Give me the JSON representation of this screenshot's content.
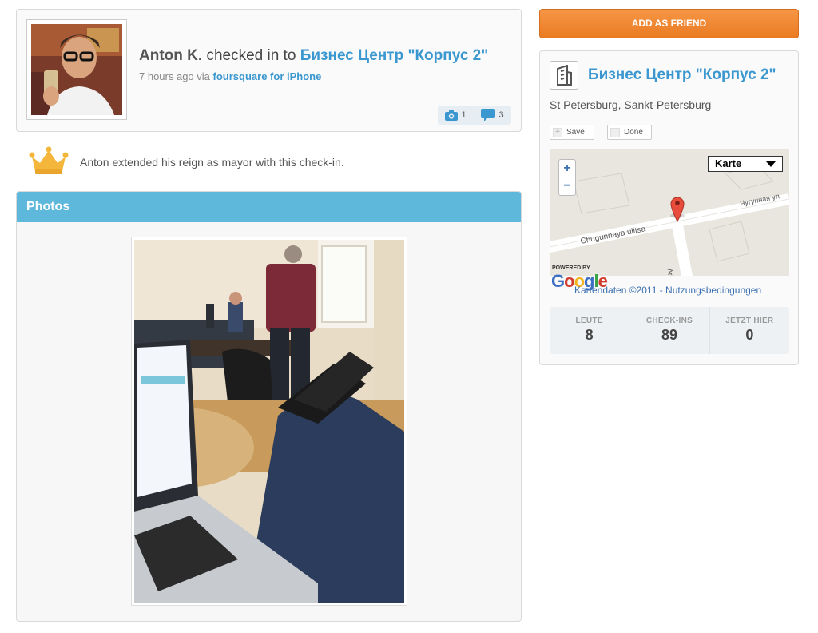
{
  "checkin": {
    "user": "Anton K.",
    "action": "checked in to",
    "venue": "Бизнес Центр \"Корпус 2\"",
    "time": "7 hours ago via",
    "app": "foursquare for iPhone",
    "photo_count": "1",
    "comment_count": "3"
  },
  "mayor": {
    "text": "Anton extended his reign as mayor with this check-in."
  },
  "photos": {
    "title": "Photos"
  },
  "actions": {
    "add_friend": "ADD AS FRIEND"
  },
  "venue": {
    "name": "Бизнес Центр \"Корпус 2\"",
    "location": "St Petersburg, Sankt-Petersburg",
    "save_label": "Save",
    "done_label": "Done"
  },
  "map": {
    "type_selected": "Karte",
    "zoom_in": "+",
    "zoom_out": "−",
    "powered_by": "POWERED BY",
    "logo_text": "Google",
    "map_data": "Kartendaten ©2011",
    "separator": " - ",
    "terms": "Nutzungsbedingungen",
    "street_1": "Chugunnaya ulitsa",
    "street_2": "Чугунная ул",
    "street_3": "Arsenal'naya"
  },
  "stats": [
    {
      "label": "LEUTE",
      "value": "8"
    },
    {
      "label": "CHECK-INS",
      "value": "89"
    },
    {
      "label": "JETZT HIER",
      "value": "0"
    }
  ],
  "colors": {
    "link_blue": "#3a97cf",
    "header_blue": "#5db8dc",
    "orange": "#ea7b23",
    "crown": "#f5b73b"
  }
}
